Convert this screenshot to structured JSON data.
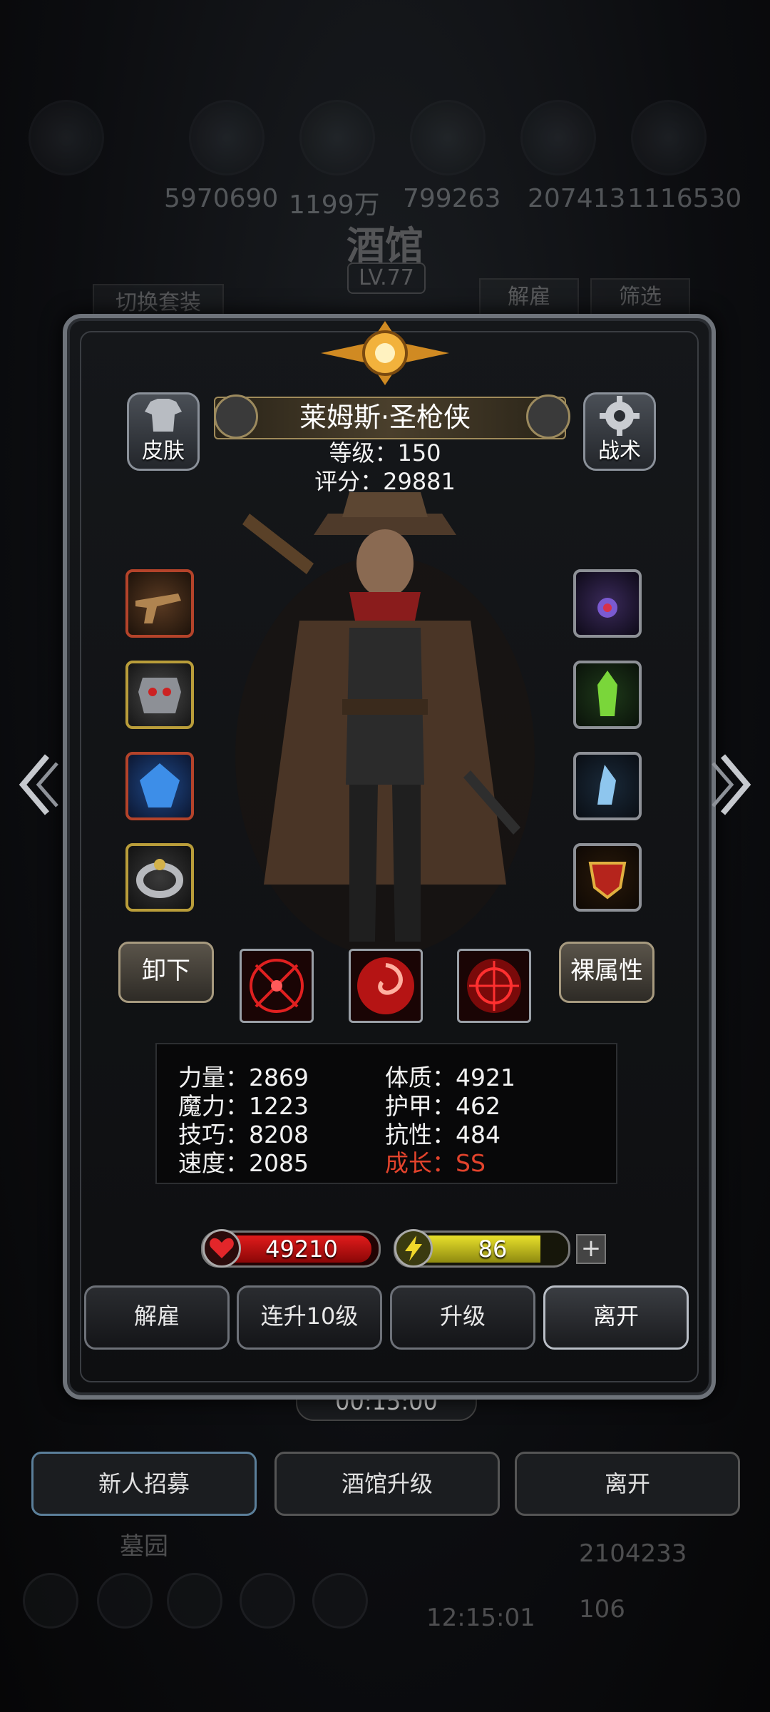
{
  "background": {
    "resources": [
      "5970690",
      "1199万",
      "799263",
      "207413",
      "1116530"
    ],
    "title": "酒馆",
    "level": "LV.77",
    "switch_outfit": "切换套装",
    "dismiss": "解雇",
    "filter": "筛选",
    "timer": "00:15:00",
    "bottom_buttons": [
      "新人招募",
      "酒馆升级",
      "离开"
    ],
    "cemetery": "墓园",
    "gold": "2104233",
    "gems": "106",
    "clock": "12:15:01"
  },
  "hero": {
    "name": "莱姆斯·圣枪侠",
    "level_line": "等级：150",
    "score_line": "评分：29881",
    "skin_label": "皮肤",
    "tactic_label": "战术",
    "unequip_label": "卸下",
    "base_attr_label": "裸属性"
  },
  "stats": {
    "strength": "力量：2869",
    "magic": "魔力：1223",
    "skill": "技巧：8208",
    "speed": "速度：2085",
    "constitution": "体质：4921",
    "armor": "护甲：462",
    "resist": "抗性：484",
    "growth": "成长：SS"
  },
  "bars": {
    "hp": "49210",
    "energy": "86",
    "energy_fraction": 0.86,
    "plus": "+"
  },
  "actions": [
    "解雇",
    "连升10级",
    "升级",
    "离开"
  ],
  "colors": {
    "growth": "#e2432c",
    "hp": "#e21b1b",
    "energy": "#e8e02b"
  }
}
